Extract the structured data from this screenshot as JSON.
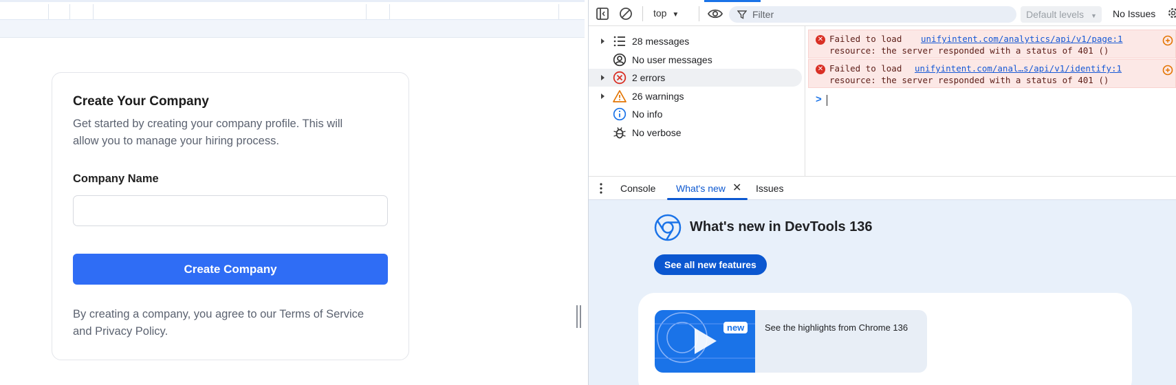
{
  "app": {
    "card": {
      "title": "Create Your Company",
      "subtitle": "Get started by creating your company profile. This will allow you to manage your hiring process.",
      "field_label": "Company Name",
      "field_value": "",
      "field_placeholder": "",
      "submit_label": "Create Company",
      "terms_text": "By creating a company, you agree to our Terms of Service and Privacy Policy."
    }
  },
  "devtools": {
    "toolbar": {
      "context": "top",
      "filter_placeholder": "Filter",
      "levels": "Default levels",
      "issues": "No Issues"
    },
    "sidebar": {
      "items": [
        {
          "label": "28 messages",
          "icon": "list-icon"
        },
        {
          "label": "No user messages",
          "icon": "user-icon"
        },
        {
          "label": "2 errors",
          "icon": "error-icon"
        },
        {
          "label": "26 warnings",
          "icon": "warning-icon"
        },
        {
          "label": "No info",
          "icon": "info-icon"
        },
        {
          "label": "No verbose",
          "icon": "bug-icon"
        }
      ]
    },
    "console": {
      "messages": [
        {
          "prefix": "Failed to load",
          "link": "unifyintent.com/analytics/api/v1/page:1",
          "text": "resource: the server responded with a status of 401 ()"
        },
        {
          "prefix": "Failed to load",
          "link": "unifyintent.com/anal…s/api/v1/identify:1",
          "text": "resource: the server responded with a status of 401 ()"
        }
      ],
      "prompt": ">"
    },
    "drawer": {
      "tabs": [
        "Console",
        "What's new",
        "Issues"
      ],
      "active_tab": "What's new"
    },
    "whats_new": {
      "title": "What's new in DevTools 136",
      "button": "See all new features",
      "badge": "new",
      "highlight": "See the highlights from Chrome 136"
    },
    "colors": {
      "accent": "#0b57d0",
      "error_bg": "#fce8e6",
      "primary_button": "#2f6df5"
    }
  }
}
